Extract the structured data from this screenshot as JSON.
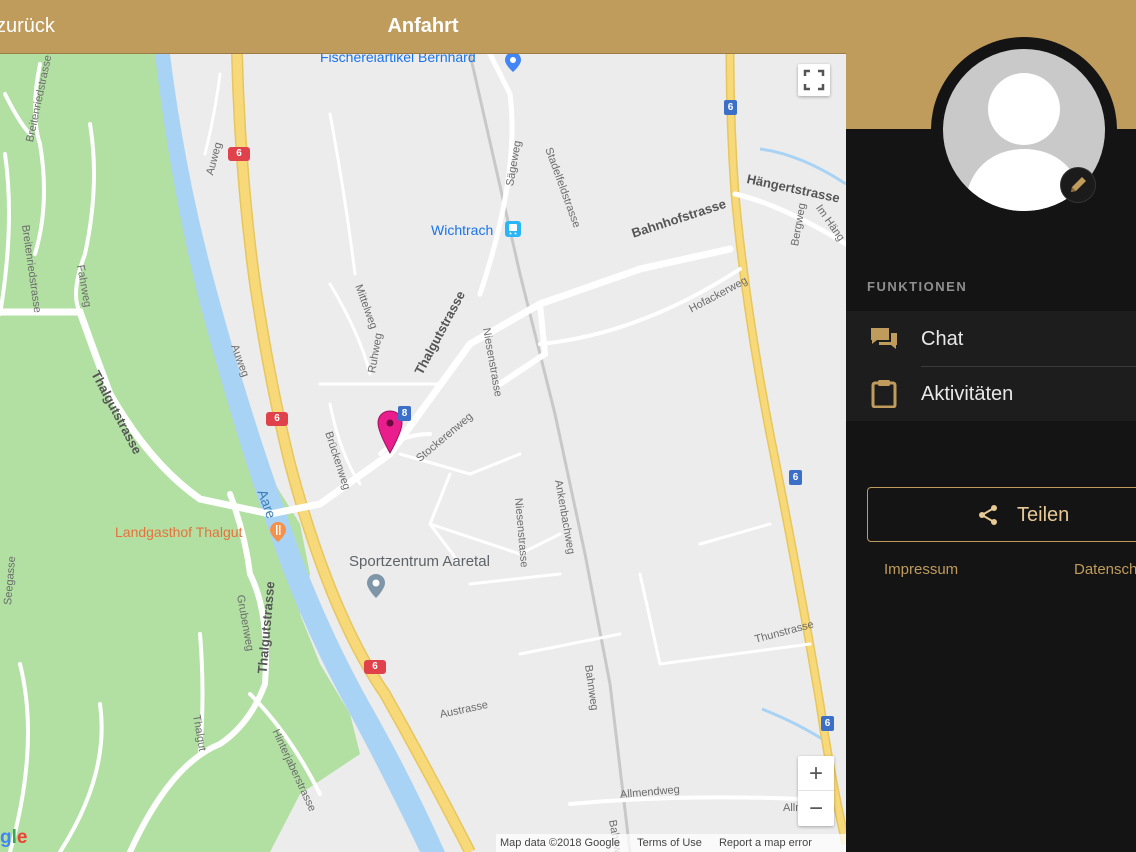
{
  "topbar": {
    "back_label": "zurück",
    "title": "Anfahrt"
  },
  "map": {
    "pois": {
      "fischerei": "Fischereiartikel Bernhard",
      "wichtrach": "Wichtrach",
      "landgasthof": "Landgasthof Thalgut",
      "sportzentrum": "Sportzentrum Aaretal"
    },
    "streets": {
      "thalgutstrasse_main": "Thalgutstrasse",
      "thalgutstrasse_left": "Thalgutstrasse",
      "thalgutstrasse_lower": "Thalgutstrasse",
      "bahnhofstrasse": "Bahnhofstrasse",
      "haengertstrasse": "Hängertstrasse",
      "breitenriedstrasse": "Breitenriedstrasse",
      "breitenriedstrasse2": "Breitenriedstrasse",
      "fahrweg": "Fahrweg",
      "auweg": "Auweg",
      "auweg2": "Auweg",
      "mittelweg": "Mittelweg",
      "ruhweg": "Ruhweg",
      "brueckenweg": "Brückenweg",
      "stockerenweg": "Stockerenweg",
      "niesenstrasse": "Niesenstrasse",
      "niesenstrasse2": "Niesenstrasse",
      "ankenbachweg": "Ankenbachweg",
      "saegeweg": "Sägeweg",
      "stadelfeldstrasse": "Stadelfeldstrasse",
      "hofackerweg": "Hofackerweg",
      "bergweg": "Bergweg",
      "im_haeng": "Im Häng",
      "thunstrasse": "Thunstrasse",
      "bahnweg": "Bahnweg",
      "allmendweg": "Allmendweg",
      "austrasse": "Austrasse",
      "grubenweg": "Grubenweg",
      "seegasse": "Seegasse",
      "thalgut": "Thalgut",
      "hinterjaberstrasse": "Hinterjaberstrasse",
      "aare": "Aare",
      "bahnweg2": "Bahnw",
      "allm": "Allm"
    },
    "route_number": "6",
    "local_route_number": "8",
    "attribution": {
      "data": "Map data ©2018 Google",
      "terms": "Terms of Use",
      "report": "Report a map error"
    },
    "zoom_in": "+",
    "zoom_out": "−",
    "logo_fragment": "gle",
    "colors": {
      "water": "#a9d3f5",
      "park": "#b1e0a2",
      "highway": "#f8d97a",
      "marker": "#e91e8c"
    }
  },
  "sidebar": {
    "section_label": "FUNKTIONEN",
    "menu": [
      {
        "label": "Chat",
        "icon": "chat-icon"
      },
      {
        "label": "Aktivitäten",
        "icon": "clipboard-icon"
      }
    ],
    "share_label": "Teilen",
    "footer": {
      "impressum": "Impressum",
      "datenschutz": "Datenschutz"
    },
    "colors": {
      "accent": "#bf9b5c",
      "background": "#141414"
    }
  }
}
